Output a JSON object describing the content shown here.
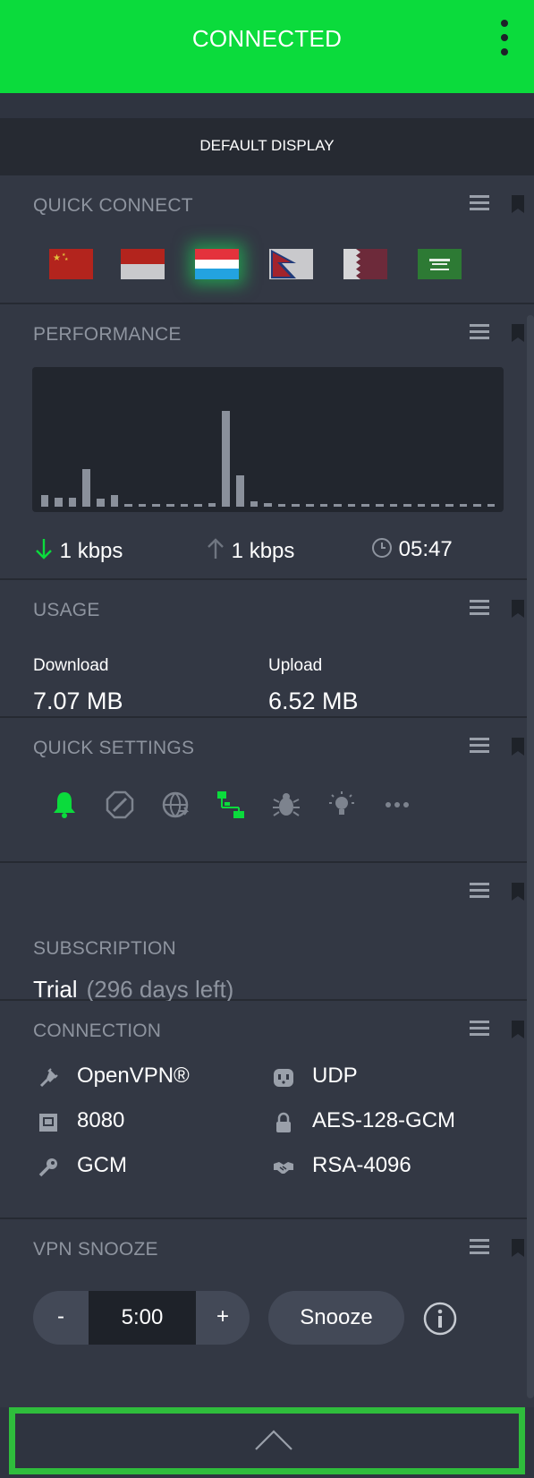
{
  "header": {
    "status": "CONNECTED",
    "menu_icon": "kebab-menu-icon"
  },
  "display_bar": {
    "label": "DEFAULT DISPLAY"
  },
  "quick_connect": {
    "title": "QUICK CONNECT",
    "flags": [
      "China",
      "Indonesia",
      "Luxembourg",
      "Nepal",
      "Qatar",
      "Saudi Arabia"
    ],
    "selected": "Luxembourg"
  },
  "performance": {
    "title": "PERFORMANCE",
    "download": "1 kbps",
    "upload": "1 kbps",
    "time": "05:47",
    "graph_levels": [
      0.09,
      0.07,
      0.07,
      0.29,
      0.06,
      0.09,
      0.02,
      0.02,
      0.02,
      0.02,
      0.02,
      0.02,
      0.03,
      0.73,
      0.24,
      0.04,
      0.03,
      0.02,
      0.02,
      0.02,
      0.02,
      0.02,
      0.02,
      0.02,
      0.02,
      0.02,
      0.02,
      0.02,
      0.02,
      0.02,
      0.02,
      0.02,
      0.02
    ]
  },
  "usage": {
    "title": "USAGE",
    "download_label": "Download",
    "download_value": "7.07 MB",
    "upload_label": "Upload",
    "upload_value": "6.52 MB"
  },
  "quick_settings": {
    "title": "QUICK SETTINGS",
    "icons": [
      "bell-icon",
      "block-icon",
      "globe-icon",
      "network-icon",
      "bug-icon",
      "bulb-icon",
      "more-icon"
    ]
  },
  "subscription": {
    "title": "SUBSCRIPTION",
    "plan": "Trial",
    "days_left": "(296 days left)"
  },
  "connection": {
    "title": "CONNECTION",
    "protocol": "OpenVPN®",
    "transport": "UDP",
    "port": "8080",
    "cipher": "AES-128-GCM",
    "auth": "GCM",
    "handshake": "RSA-4096"
  },
  "vpn_snooze": {
    "title": "VPN SNOOZE",
    "minus_label": "-",
    "value": "5:00",
    "plus_label": "+",
    "snooze_label": "Snooze"
  },
  "colors": {
    "accent": "#0bdb3c",
    "background": "#2f3440",
    "panel": "#333844"
  }
}
